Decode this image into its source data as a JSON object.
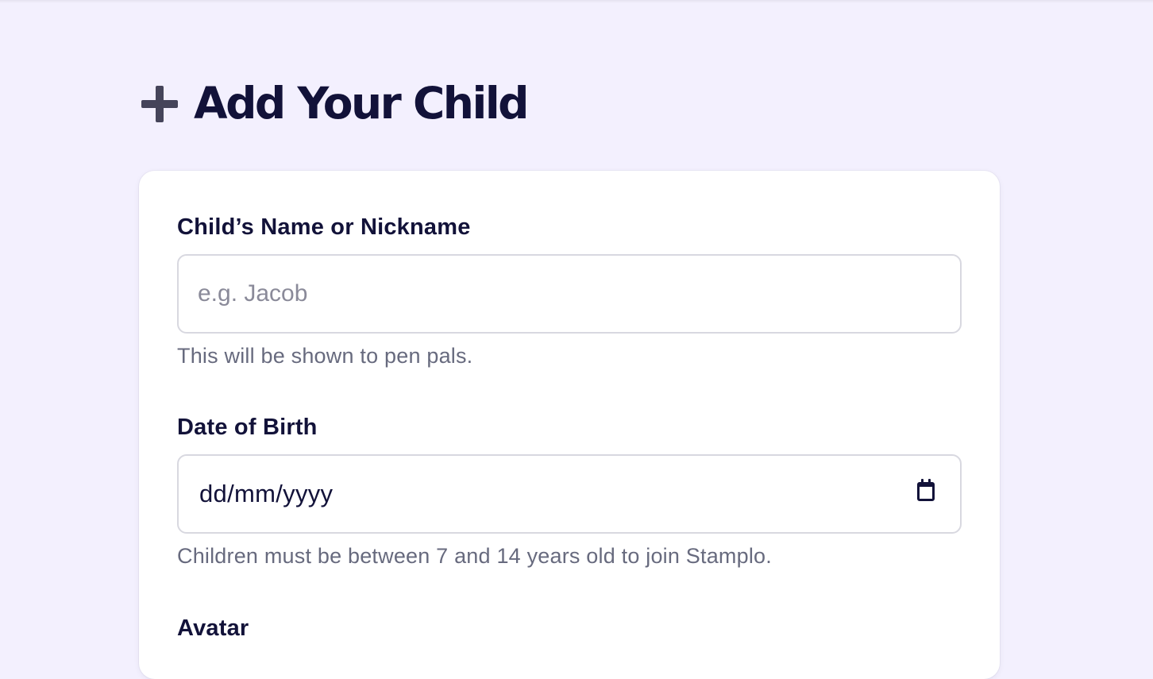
{
  "header": {
    "title": "Add Your Child",
    "icon": "plus-icon"
  },
  "form": {
    "name_field": {
      "label": "Child’s Name or Nickname",
      "placeholder": "e.g. Jacob",
      "value": "",
      "hint": "This will be shown to pen pals."
    },
    "dob_field": {
      "label": "Date of Birth",
      "value": "dd/mm/yyyy",
      "icon": "calendar-icon",
      "hint": "Children must be between 7 and 14 years old to join Stamplo."
    },
    "avatar_field": {
      "label": "Avatar"
    }
  },
  "colors": {
    "background": "#f3f0fe",
    "title": "#121239",
    "hint": "#676a7e",
    "border": "#d8d8e0"
  }
}
